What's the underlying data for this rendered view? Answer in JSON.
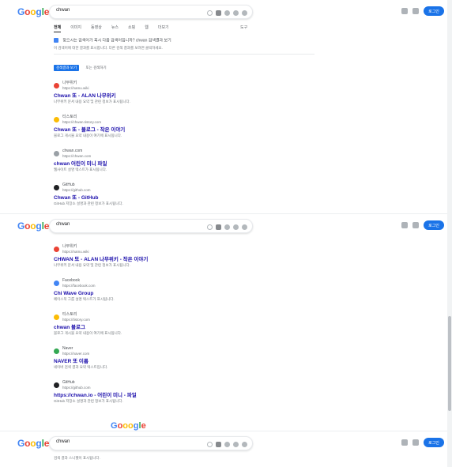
{
  "header": {
    "logo": [
      "G",
      "o",
      "o",
      "g",
      "l",
      "e"
    ],
    "logo_colors": [
      "#4285f4",
      "#ea4335",
      "#fbbc05",
      "#4285f4",
      "#34a853",
      "#ea4335"
    ],
    "query": "chwan",
    "signin_label": "로그인"
  },
  "tabs": [
    "전체",
    "이미지",
    "동영상",
    "뉴스",
    "쇼핑",
    "웹",
    "더보기"
  ],
  "tools_label": "도구",
  "notice": "찾으시는 검색어가 혹시 다음 검색어입니까? chwan 검색결과 보기",
  "notice_line2": "이 검색어에 대한 결과를 표시합니다. 다른 검색 결과를 보려면 클릭하세요.",
  "chip": "검색결과 보기",
  "chip_note": "또는 검색하기",
  "page_top_results": [
    {
      "site": "나무위키",
      "url": "https://namu.wiki",
      "title": "Chwan 또 - ALAN 나무위키",
      "desc": "나무위키 문서 내용 요약 및 관련 정보가 표시됩니다.",
      "fav": "#ea4335"
    },
    {
      "site": "티스토리",
      "url": "https://chwan.tistory.com",
      "title": "Chwan 또 - 블로그 - 작은 이야기",
      "desc": "블로그 게시물 요약 내용이 여기에 표시됩니다.",
      "fav": "#fbbc05"
    },
    {
      "site": "chwan.com",
      "url": "https://chwan.com",
      "title": "chwan 어린이 미니 파일",
      "desc": "웹사이트 설명 텍스트가 표시됩니다.",
      "fav": "#9aa0a6"
    },
    {
      "site": "GitHub",
      "url": "https://github.com",
      "title": "Chwan 또 - GitHub",
      "desc": "GitHub 저장소 설명과 관련 정보가 표시됩니다.",
      "fav": "#202124"
    }
  ],
  "page_mid_results": [
    {
      "site": "나무위키",
      "url": "https://namu.wiki",
      "title": "CHWAN 또 - ALAN 나무위키 - 작은 이야기",
      "desc": "나무위키 문서 내용 요약 및 관련 정보가 표시됩니다.",
      "fav": "#ea4335"
    },
    {
      "site": "Facebook",
      "url": "https://facebook.com",
      "title": "Chi Wave Group",
      "desc": "페이스북 그룹 설명 텍스트가 표시됩니다.",
      "fav": "#4285f4"
    },
    {
      "site": "티스토리",
      "url": "https://tistory.com",
      "title": "chwan 블로그",
      "desc": "블로그 게시물 요약 내용이 여기에 표시됩니다.",
      "fav": "#fbbc05"
    },
    {
      "site": "Naver",
      "url": "https://naver.com",
      "title": "NAVER 또 이름",
      "desc": "네이버 검색 결과 요약 텍스트입니다.",
      "fav": "#34a853"
    },
    {
      "site": "GitHub",
      "url": "https://github.com",
      "title": "https://chwan.io - 어린이 미니 - 파일",
      "desc": "GitHub 저장소 설명과 관련 정보가 표시됩니다.",
      "fav": "#202124"
    }
  ],
  "pager_logo": [
    "G",
    "o",
    "o",
    "o",
    "g",
    "l",
    "e"
  ],
  "pager_colors": [
    "#4285f4",
    "#ea4335",
    "#fbbc05",
    "#fbbc05",
    "#4285f4",
    "#34a853",
    "#ea4335"
  ],
  "bottom_snippet": "검색 결과 스니펫이 표시됩니다."
}
